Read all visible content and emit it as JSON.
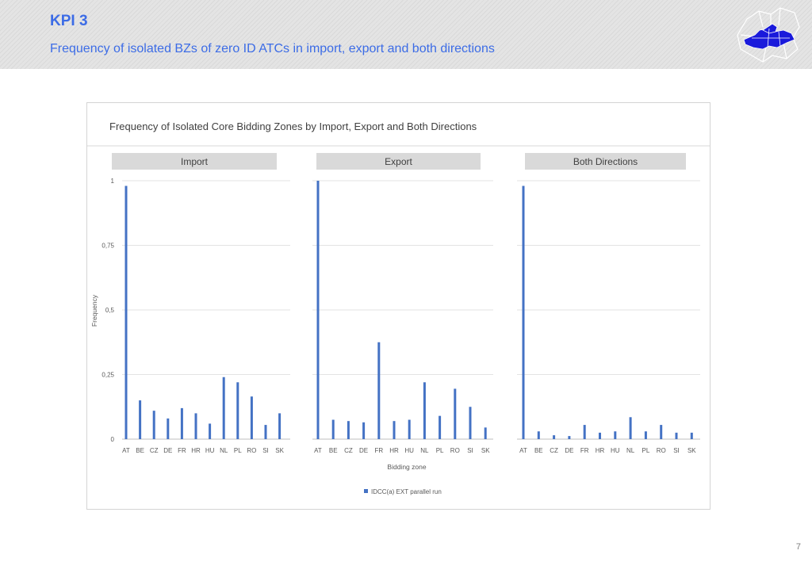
{
  "header": {
    "kpi": "KPI 3",
    "subtitle": "Frequency of isolated BZs of zero ID ATCs in import, export and both directions"
  },
  "page_number": "7",
  "colors": {
    "accent": "#3c6ce6",
    "bar": "#4472c4",
    "panel_header": "#d9d9d9"
  },
  "chart_data": {
    "type": "bar",
    "title": "Frequency of Isolated Core Bidding Zones by Import, Export and Both Directions",
    "ylabel": "Frequency",
    "xlabel": "Bidding zone",
    "ylim": [
      0,
      1
    ],
    "yticks": [
      "0",
      "0,25",
      "0,5",
      "0,75",
      "1"
    ],
    "categories": [
      "AT",
      "BE",
      "CZ",
      "DE",
      "FR",
      "HR",
      "HU",
      "NL",
      "PL",
      "RO",
      "SI",
      "SK"
    ],
    "grid": true,
    "legend": {
      "position": "bottom",
      "entries": [
        "IDCC(a) EXT parallel run"
      ]
    },
    "panels": [
      {
        "name": "Import",
        "series": [
          {
            "name": "IDCC(a) EXT parallel run",
            "values": [
              0.98,
              0.15,
              0.11,
              0.08,
              0.12,
              0.1,
              0.06,
              0.24,
              0.22,
              0.165,
              0.055,
              0.1
            ]
          }
        ]
      },
      {
        "name": "Export",
        "series": [
          {
            "name": "IDCC(a) EXT parallel run",
            "values": [
              1.0,
              0.075,
              0.07,
              0.065,
              0.375,
              0.07,
              0.075,
              0.22,
              0.09,
              0.195,
              0.125,
              0.045
            ]
          }
        ]
      },
      {
        "name": "Both Directions",
        "series": [
          {
            "name": "IDCC(a) EXT parallel run",
            "values": [
              0.98,
              0.03,
              0.015,
              0.012,
              0.055,
              0.025,
              0.03,
              0.085,
              0.03,
              0.055,
              0.025,
              0.025
            ]
          }
        ]
      }
    ]
  }
}
